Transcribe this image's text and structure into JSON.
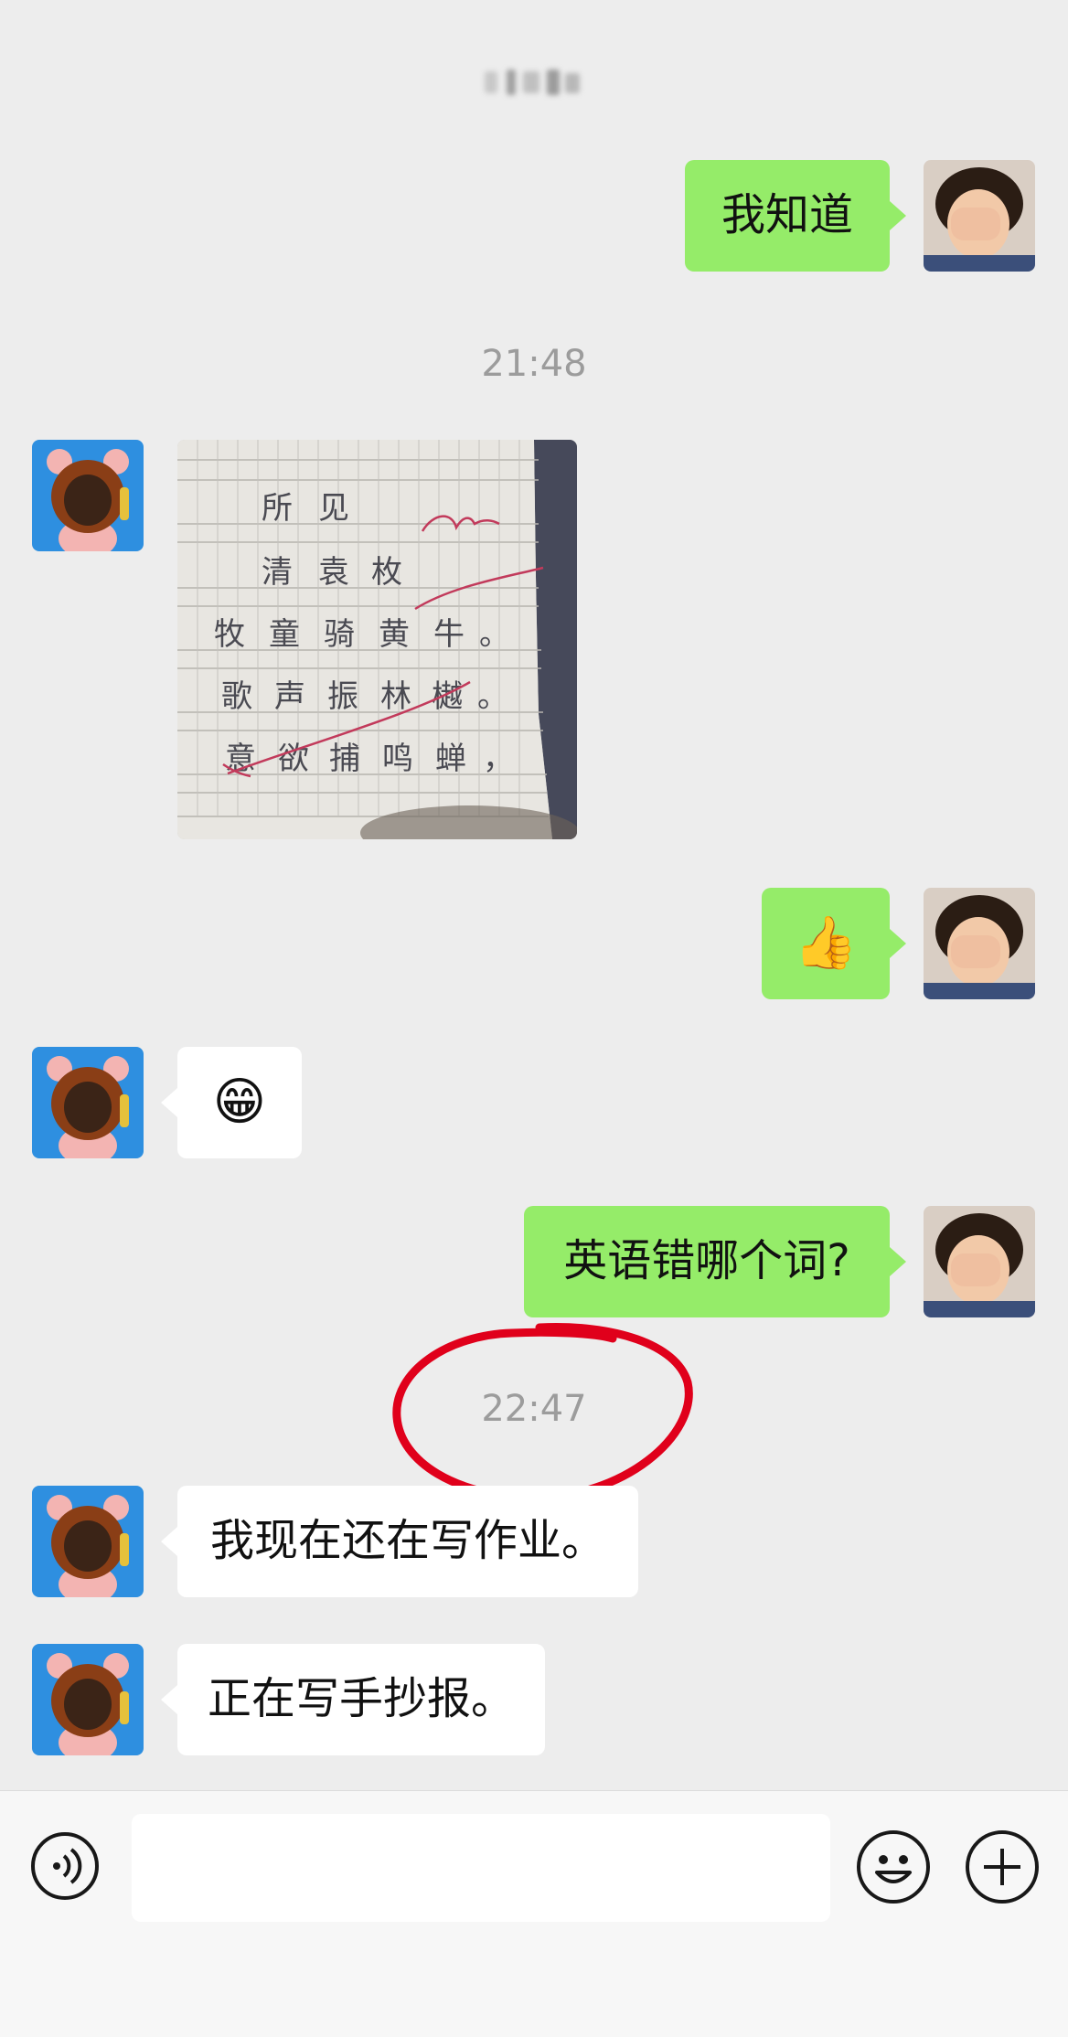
{
  "header": {
    "title": ""
  },
  "messages": [
    {
      "side": "right",
      "type": "text",
      "text": "我知道"
    },
    {
      "type": "time",
      "text": "21:48"
    },
    {
      "side": "left",
      "type": "image",
      "image": "handwriting-photo"
    },
    {
      "side": "right",
      "type": "emoji",
      "text": "👍"
    },
    {
      "side": "left",
      "type": "emoji",
      "text": "😁"
    },
    {
      "side": "right",
      "type": "text",
      "text": "英语错哪个词?"
    },
    {
      "type": "time",
      "text": "22:47",
      "annotation": "red-circle"
    },
    {
      "side": "left",
      "type": "text",
      "text": "我现在还在写作业。"
    },
    {
      "side": "left",
      "type": "text",
      "text": "正在写手抄报。"
    }
  ],
  "homework_photo": {
    "rows": [
      [
        "所",
        "见"
      ],
      [
        "清",
        "袁",
        "枚"
      ],
      [
        "牧",
        "童",
        "骑",
        "黄",
        "牛",
        "。"
      ],
      [
        "歌",
        "声",
        "振",
        "林",
        "樾",
        "。"
      ],
      [
        "意",
        "欲",
        "捕",
        "鸣",
        "蝉",
        "，"
      ]
    ]
  },
  "composer": {
    "voice_icon": "voice-icon",
    "input_value": "",
    "emoji_icon": "smiley-icon",
    "plus_icon": "plus-icon"
  },
  "colors": {
    "background": "#ededed",
    "own_bubble": "#95ec69",
    "other_bubble": "#ffffff",
    "annotation": "#e0001b"
  }
}
